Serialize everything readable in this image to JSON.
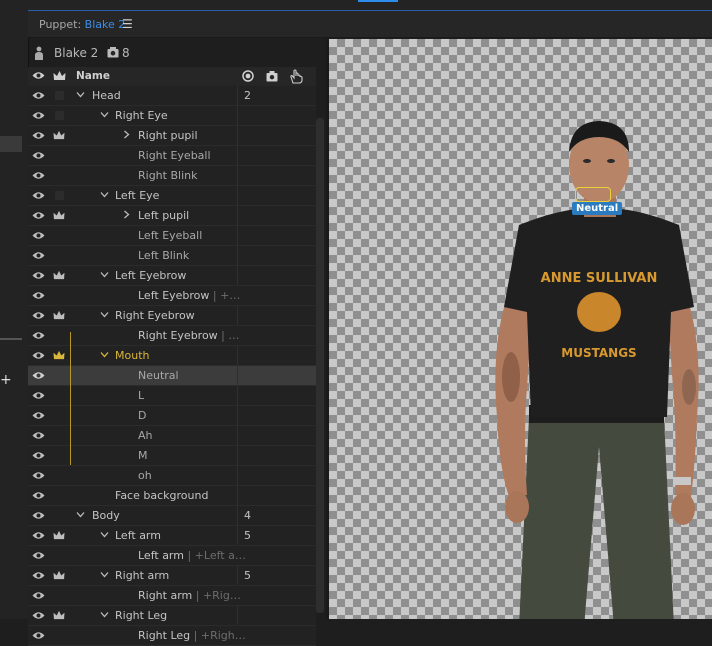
{
  "panel": {
    "title_prefix": "Puppet: ",
    "puppet_name": "Blake 2",
    "menu_icon": "hamburger-menu-icon"
  },
  "puppet_info": {
    "name": "Blake 2",
    "count": "8"
  },
  "columns": {
    "name": "Name"
  },
  "rows": [
    {
      "label": "Head",
      "count": "2"
    },
    {
      "label": "Right Eye"
    },
    {
      "label": "Right pupil"
    },
    {
      "label": "Right Eyeball"
    },
    {
      "label": "Right Blink"
    },
    {
      "label": "Left Eye"
    },
    {
      "label": "Left pupil"
    },
    {
      "label": "Left Eyeball"
    },
    {
      "label": "Left Blink"
    },
    {
      "label": "Left Eyebrow"
    },
    {
      "label": "Left Eyebrow",
      "alt": " | +…"
    },
    {
      "label": "Right Eyebrow"
    },
    {
      "label": "Right Eyebrow",
      "alt": " | …"
    },
    {
      "label": "Mouth"
    },
    {
      "label": "Neutral"
    },
    {
      "label": "L"
    },
    {
      "label": "D"
    },
    {
      "label": "Ah"
    },
    {
      "label": "M"
    },
    {
      "label": "oh"
    },
    {
      "label": "Face background"
    },
    {
      "label": "Body",
      "count": "4"
    },
    {
      "label": "Left arm",
      "count": "5"
    },
    {
      "label": "Left arm",
      "alt": " | +Left a…"
    },
    {
      "label": "Right arm",
      "count": "5"
    },
    {
      "label": "Right arm",
      "alt": " | +Rig…"
    },
    {
      "label": "Right Leg"
    },
    {
      "label": "Right Leg",
      "alt": " | +Righ…"
    }
  ],
  "canvas": {
    "tag_label": "Neutral"
  },
  "colors": {
    "accent_blue": "#3b8eea",
    "selected_yellow": "#d9b73c"
  }
}
